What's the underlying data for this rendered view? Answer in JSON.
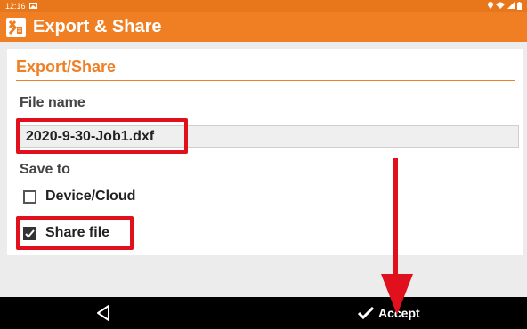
{
  "status_bar": {
    "time": "12:16"
  },
  "app_bar": {
    "title": "Export & Share"
  },
  "card": {
    "header": "Export/Share",
    "file_name_label": "File name",
    "file_name_value": "2020-9-30-Job1.dxf",
    "save_to_label": "Save to",
    "options": [
      {
        "label": "Device/Cloud",
        "checked": false
      },
      {
        "label": "Share file",
        "checked": true
      }
    ]
  },
  "nav_bar": {
    "accept_label": "Accept"
  },
  "colors": {
    "accent": "#ef7f22",
    "highlight": "#e0101c",
    "nav": "#000000"
  },
  "icons": [
    "back-triangle-icon",
    "checkmark-icon",
    "app-logo-icon"
  ]
}
